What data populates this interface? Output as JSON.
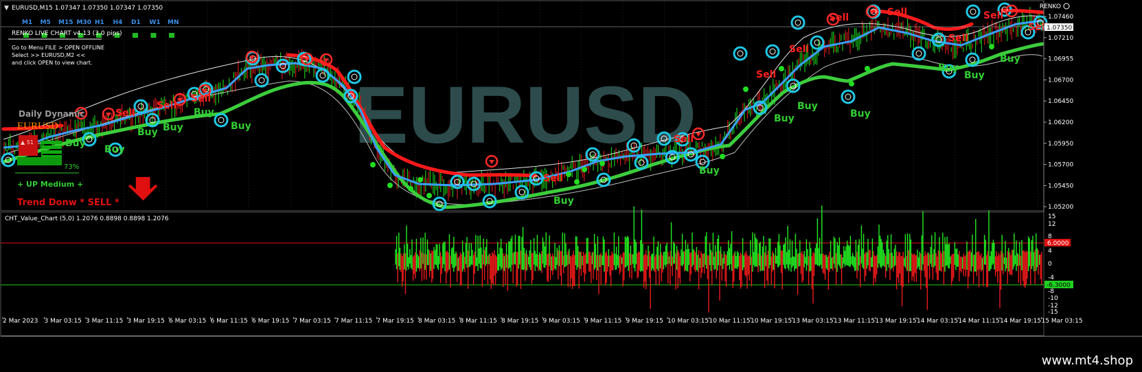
{
  "header": {
    "symbol_info": "EURUSD,M15  1.07347 1.07350 1.07347 1.07350",
    "renko_label": "RENKO",
    "current_price": "1.07350"
  },
  "timeframes": [
    "M1",
    "M5",
    "M15",
    "M30",
    "H1",
    "H4",
    "D1",
    "W1",
    "MN"
  ],
  "renko_panel": {
    "title": "RENKO LIVE CHART v4.13 (3.0 pips)",
    "lines": [
      "Go to Menu FILE > OPEN OFFLINE",
      "Select >> EURUSD,M2 <<",
      "and click OPEN to view chart."
    ]
  },
  "watermark": "EURUSD",
  "dashboard": {
    "title": "Daily Dynamic",
    "symbol": "EURUSD",
    "percent": "73%",
    "strength": "+ UP Medium +",
    "trend": "Trend Donw * SELL *"
  },
  "signals": {
    "buy": "Buy",
    "sell": "Sell",
    "buy_positions": [
      [
        95,
        213
      ],
      [
        152,
        222
      ],
      [
        200,
        197
      ],
      [
        237,
        190
      ],
      [
        282,
        168
      ],
      [
        336,
        188
      ],
      [
        806,
        297
      ],
      [
        1018,
        253
      ],
      [
        1127,
        177
      ],
      [
        1161,
        159
      ],
      [
        1238,
        170
      ],
      [
        1366,
        103
      ],
      [
        1404,
        114
      ],
      [
        1456,
        90
      ]
    ],
    "sell_positions": [
      [
        168,
        169
      ],
      [
        228,
        158
      ],
      [
        278,
        148
      ],
      [
        791,
        264
      ],
      [
        981,
        207
      ],
      [
        1101,
        113
      ],
      [
        1149,
        76
      ],
      [
        1207,
        30
      ],
      [
        1292,
        22
      ],
      [
        1381,
        60
      ],
      [
        1432,
        27
      ],
      [
        1497,
        44
      ]
    ]
  },
  "price_axis": {
    "labels": [
      "1.07460",
      "1.07210",
      "1.06955",
      "1.06700",
      "1.06450",
      "1.06200",
      "1.05950",
      "1.05700",
      "1.05450",
      "1.05200"
    ]
  },
  "indicator": {
    "title": "CHT_Value_Chart (5,0) 1.2076 0.8898 0.8898 1.2076",
    "axis_labels": [
      "15",
      "12",
      "8",
      "4",
      "0",
      "-4",
      "-8",
      "-10",
      "-12",
      "-15"
    ],
    "upper_level": "6.0000",
    "lower_level": "-6.3000"
  },
  "time_axis": {
    "labels": [
      "2 Mar 2023",
      "3 Mar 03:15",
      "3 Mar 11:15",
      "3 Mar 19:15",
      "6 Mar 03:15",
      "6 Mar 11:15",
      "6 Mar 19:15",
      "7 Mar 03:15",
      "7 Mar 11:15",
      "7 Mar 19:15",
      "8 Mar 03:15",
      "8 Mar 11:15",
      "8 Mar 19:15",
      "9 Mar 03:15",
      "9 Mar 11:15",
      "9 Mar 19:15",
      "10 Mar 03:15",
      "10 Mar 11:15",
      "10 Mar 19:15",
      "13 Mar 03:15",
      "13 Mar 11:15",
      "13 Mar 19:15",
      "14 Mar 03:15",
      "14 Mar 11:15",
      "14 Mar 19:15",
      "15 Mar 03:15"
    ]
  },
  "footer": {
    "site": "www.mt4.shop"
  },
  "colors": {
    "background": "#000000",
    "buy": "#32cd32",
    "sell": "#ff2020",
    "circle": "#1ec8e6",
    "up_bar": "#00e000",
    "down_bar": "#ff1a1a",
    "grid": "#2c2c2c"
  }
}
